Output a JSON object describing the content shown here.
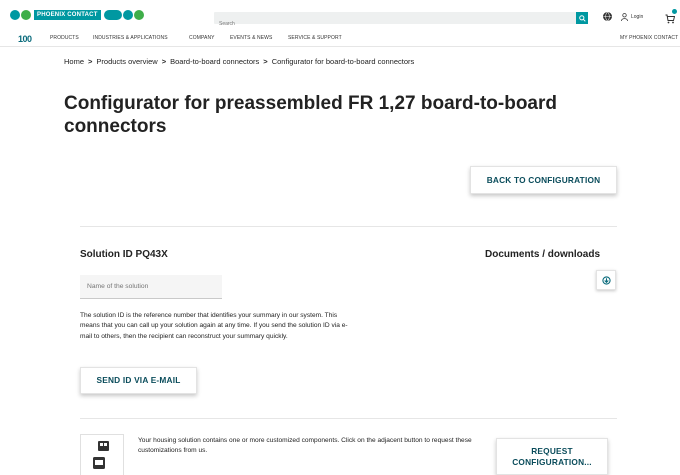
{
  "header": {
    "logo_text": "PHOENIX CONTACT",
    "search_placeholder": "Search",
    "login_label": "Login",
    "anniversary_badge": "100"
  },
  "nav": {
    "items": [
      "PRODUCTS",
      "INDUSTRIES & APPLICATIONS",
      "COMPANY",
      "EVENTS & NEWS",
      "SERVICE & SUPPORT"
    ],
    "right_item": "MY PHOENIX CONTACT"
  },
  "breadcrumb": {
    "items": [
      "Home",
      "Products overview",
      "Board-to-board connectors",
      "Configurator for board-to-board connectors"
    ],
    "separator": ">"
  },
  "page": {
    "title": "Configurator for preassembled FR 1,27 board-to-board connectors",
    "back_button": "BACK TO CONFIGURATION"
  },
  "solution": {
    "title": "Solution ID PQ43X",
    "name_placeholder": "Name of the solution",
    "description": "The solution ID is the reference number that identifies your summary in our system. This means that you can call up your solution again at any time. If you send the solution ID via e-mail to others, then the recipient can reconstruct your summary quickly.",
    "send_button": "SEND ID VIA E-MAIL"
  },
  "documents": {
    "title": "Documents / downloads"
  },
  "housing": {
    "text": "Your housing solution contains one or more customized components. Click on the adjacent button to request these customizations from us.",
    "request_button": "REQUEST CONFIGURATION..."
  },
  "colors": {
    "brand_teal": "#0098a1",
    "brand_green": "#3fae49",
    "button_text": "#0a4c5b"
  },
  "icons": [
    "search-icon",
    "globe-icon",
    "user-icon",
    "cart-icon",
    "download-icon",
    "housing-icon"
  ]
}
